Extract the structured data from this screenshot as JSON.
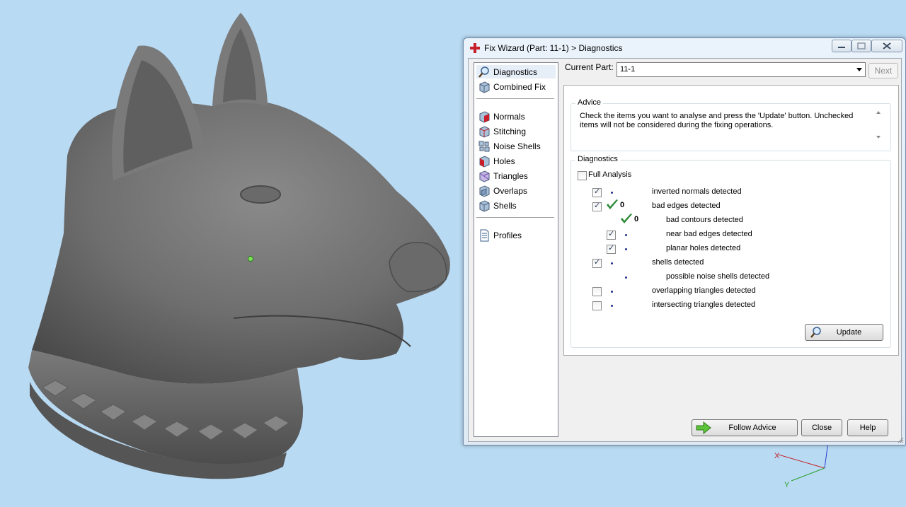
{
  "dialog": {
    "title": "Fix Wizard (Part: 11-1) > Diagnostics"
  },
  "sidebar": {
    "items": [
      {
        "label": "Diagnostics",
        "icon": "magnifier-icon",
        "selected": true
      },
      {
        "label": "Combined Fix",
        "icon": "cube-icon"
      },
      {
        "label": "Normals",
        "icon": "normals-cube-icon"
      },
      {
        "label": "Stitching",
        "icon": "stitching-cube-icon"
      },
      {
        "label": "Noise Shells",
        "icon": "noise-shells-icon"
      },
      {
        "label": "Holes",
        "icon": "holes-cube-icon"
      },
      {
        "label": "Triangles",
        "icon": "triangles-cube-icon"
      },
      {
        "label": "Overlaps",
        "icon": "overlaps-cube-icon"
      },
      {
        "label": "Shells",
        "icon": "shells-cube-icon"
      },
      {
        "label": "Profiles",
        "icon": "document-icon"
      }
    ]
  },
  "toolbar": {
    "current_part_label": "Current Part:",
    "current_part_value": "11-1",
    "next_label": "Next"
  },
  "advice": {
    "title": "Advice",
    "text": "Check the items you want to analyse and press the 'Update' button. Unchecked items will not be considered during the fixing operations."
  },
  "diagnostics": {
    "title": "Diagnostics",
    "full_analysis_label": "Full Analysis",
    "full_analysis_checked": false,
    "rows": [
      {
        "label": "inverted normals detected",
        "checked": true,
        "status": "dot",
        "indent": 0
      },
      {
        "label": "bad edges detected",
        "checked": true,
        "status": "ok",
        "count": "0",
        "indent": 0
      },
      {
        "label": "bad contours detected",
        "checked": null,
        "status": "ok",
        "count": "0",
        "indent": 1
      },
      {
        "label": "near bad edges detected",
        "checked": true,
        "status": "dot",
        "indent": 1
      },
      {
        "label": "planar holes detected",
        "checked": true,
        "status": "dot",
        "indent": 1
      },
      {
        "label": "shells detected",
        "checked": true,
        "status": "dot",
        "indent": 0
      },
      {
        "label": "possible noise shells detected",
        "checked": null,
        "status": "dot",
        "indent": 1
      },
      {
        "label": "overlapping triangles detected",
        "checked": false,
        "status": "dot",
        "indent": 0
      },
      {
        "label": "intersecting triangles detected",
        "checked": false,
        "status": "dot",
        "indent": 0
      }
    ],
    "update_label": "Update"
  },
  "footer": {
    "follow_advice_label": "Follow Advice",
    "close_label": "Close",
    "help_label": "Help"
  },
  "viewport": {
    "model_color": "#6f6f6f",
    "background_color": "#b9daf3",
    "axis_x_label": "X",
    "axis_y_label": "Y"
  },
  "colors": {
    "ok_check": "#2e8b3a",
    "status_dot": "#1b2f8a",
    "close_red": "#c8202a"
  }
}
